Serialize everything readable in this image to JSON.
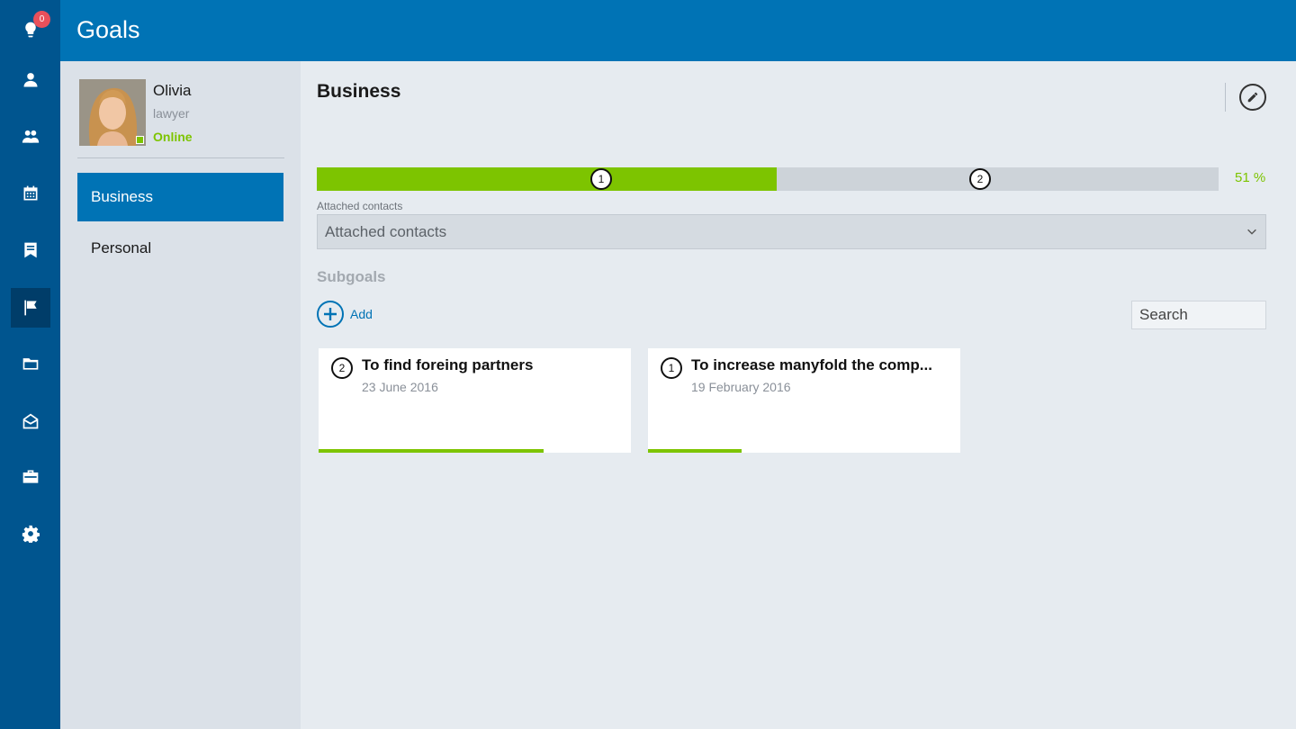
{
  "header": {
    "title": "Goals"
  },
  "rail": {
    "badge_count": "0",
    "items": [
      {
        "icon": "lightbulb-icon"
      },
      {
        "icon": "person-icon"
      },
      {
        "icon": "group-icon"
      },
      {
        "icon": "calendar-icon"
      },
      {
        "icon": "notes-icon"
      },
      {
        "icon": "flag-icon",
        "active": true
      },
      {
        "icon": "folder-icon"
      },
      {
        "icon": "mail-icon"
      },
      {
        "icon": "briefcase-icon"
      },
      {
        "icon": "gear-icon"
      }
    ]
  },
  "profile": {
    "name": "Olivia",
    "role": "lawyer",
    "status": "Online"
  },
  "categories": [
    {
      "label": "Business",
      "active": true
    },
    {
      "label": "Personal",
      "active": false
    }
  ],
  "main": {
    "title": "Business",
    "progress": {
      "percent": 51,
      "percent_label": "51 %",
      "markers": [
        "1",
        "2"
      ]
    },
    "contacts_label": "Attached contacts",
    "contacts_value": "Attached contacts",
    "subgoals_title": "Subgoals",
    "add_label": "Add",
    "search_placeholder": "Search"
  },
  "subgoals": [
    {
      "number": "2",
      "title": "To find foreing partners",
      "date": "23 June 2016",
      "progress": 0.72
    },
    {
      "number": "1",
      "title": "To increase manyfold the comp...",
      "date": "19 February 2016",
      "progress": 0.3
    }
  ],
  "colors": {
    "accent": "#0073b5",
    "rail": "#00558f",
    "success": "#7dc400",
    "badge": "#e8505b"
  }
}
